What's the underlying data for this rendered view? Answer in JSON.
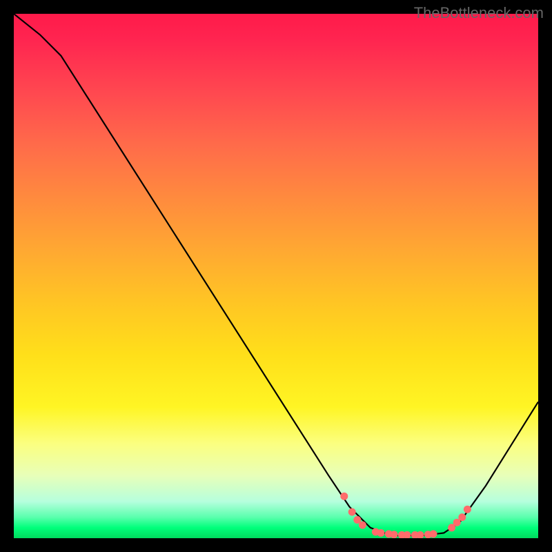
{
  "watermark": "TheBottleneck.com",
  "chart_data": {
    "type": "line",
    "title": "",
    "xlabel": "",
    "ylabel": "",
    "xlim": [
      0,
      100
    ],
    "ylim": [
      0,
      100
    ],
    "curve": [
      {
        "x": 0,
        "y": 100
      },
      {
        "x": 5,
        "y": 96
      },
      {
        "x": 9,
        "y": 92
      },
      {
        "x": 60,
        "y": 12
      },
      {
        "x": 64,
        "y": 6
      },
      {
        "x": 68,
        "y": 2
      },
      {
        "x": 72,
        "y": 0.5
      },
      {
        "x": 78,
        "y": 0.5
      },
      {
        "x": 82,
        "y": 1
      },
      {
        "x": 85,
        "y": 3
      },
      {
        "x": 90,
        "y": 10
      },
      {
        "x": 95,
        "y": 18
      },
      {
        "x": 100,
        "y": 26
      }
    ],
    "markers": [
      {
        "x": 63,
        "y": 8
      },
      {
        "x": 64.5,
        "y": 5
      },
      {
        "x": 65.5,
        "y": 3.5
      },
      {
        "x": 66.5,
        "y": 2.5
      },
      {
        "x": 69,
        "y": 1.2
      },
      {
        "x": 70,
        "y": 1
      },
      {
        "x": 71.5,
        "y": 0.8
      },
      {
        "x": 72.5,
        "y": 0.7
      },
      {
        "x": 74,
        "y": 0.6
      },
      {
        "x": 75,
        "y": 0.6
      },
      {
        "x": 76.5,
        "y": 0.6
      },
      {
        "x": 77.5,
        "y": 0.6
      },
      {
        "x": 79,
        "y": 0.7
      },
      {
        "x": 80,
        "y": 0.8
      },
      {
        "x": 83.5,
        "y": 2
      },
      {
        "x": 84.5,
        "y": 3
      },
      {
        "x": 85.5,
        "y": 4
      },
      {
        "x": 86.5,
        "y": 5.5
      }
    ],
    "marker_color": "#ff6b6b",
    "line_color": "#000000",
    "gradient_stops": [
      {
        "pos": 0,
        "color": "#ff1a4a"
      },
      {
        "pos": 25,
        "color": "#ff6b4a"
      },
      {
        "pos": 50,
        "color": "#ffb828"
      },
      {
        "pos": 75,
        "color": "#fff524"
      },
      {
        "pos": 95,
        "color": "#5affad"
      },
      {
        "pos": 100,
        "color": "#00db5e"
      }
    ]
  }
}
